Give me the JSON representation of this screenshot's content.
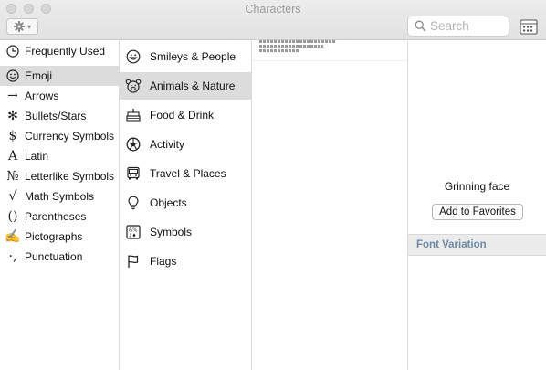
{
  "window": {
    "title": "Characters"
  },
  "toolbar": {
    "gear_caret": "▾"
  },
  "search": {
    "placeholder": "Search"
  },
  "categories": [
    {
      "label": "Frequently Used",
      "icon": "clock-icon"
    },
    {
      "label": "Emoji",
      "icon": "smiley-icon",
      "selected": true
    },
    {
      "label": "Arrows",
      "icon": "arrow-icon",
      "glyph": "→"
    },
    {
      "label": "Bullets/Stars",
      "icon": "asterisk-icon",
      "glyph": "✻"
    },
    {
      "label": "Currency Symbols",
      "icon": "dollar-icon",
      "glyph": "$"
    },
    {
      "label": "Latin",
      "icon": "latin-a-icon",
      "glyph": "A"
    },
    {
      "label": "Letterlike Symbols",
      "icon": "numero-icon",
      "glyph": "№"
    },
    {
      "label": "Math Symbols",
      "icon": "sqrt-icon",
      "glyph": "√"
    },
    {
      "label": "Parentheses",
      "icon": "parentheses-icon",
      "glyph": "()"
    },
    {
      "label": "Pictographs",
      "icon": "pencil-icon",
      "glyph": "✍"
    },
    {
      "label": "Punctuation",
      "icon": "punctuation-icon",
      "glyph": "·,"
    }
  ],
  "subcategories": [
    {
      "label": "Smileys & People",
      "icon": "smiley-icon"
    },
    {
      "label": "Animals & Nature",
      "icon": "bear-icon",
      "selected": true
    },
    {
      "label": "Food & Drink",
      "icon": "cake-icon"
    },
    {
      "label": "Activity",
      "icon": "soccer-ball-icon"
    },
    {
      "label": "Travel & Places",
      "icon": "bus-icon"
    },
    {
      "label": "Objects",
      "icon": "lightbulb-icon"
    },
    {
      "label": "Symbols",
      "icon": "symbols-icon"
    },
    {
      "label": "Flags",
      "icon": "flag-icon"
    }
  ],
  "detail": {
    "name": "Grinning face",
    "favorite_button": "Add to Favorites",
    "font_variation_header": "Font Variation"
  }
}
